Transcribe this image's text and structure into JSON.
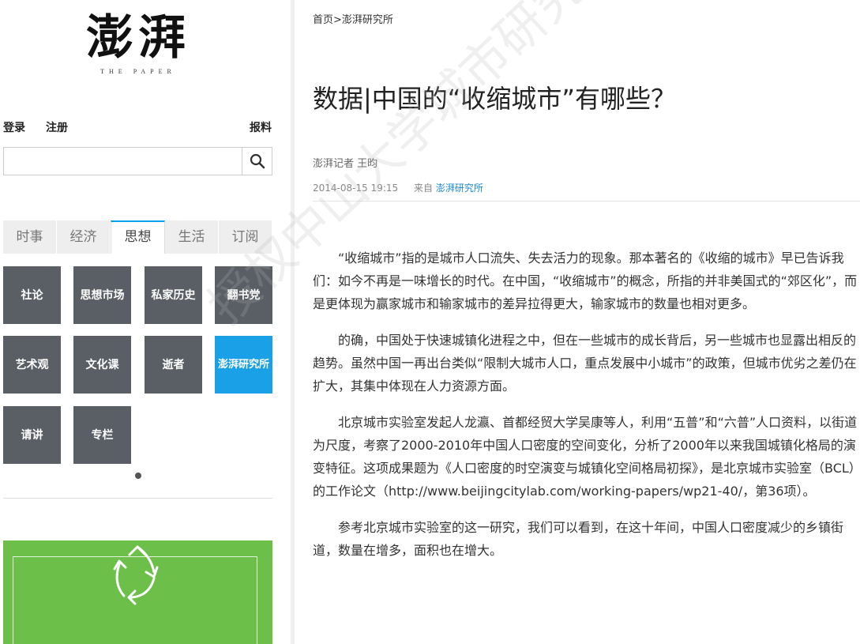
{
  "logo": {
    "cn": "澎湃",
    "en": "THE PAPER"
  },
  "auth": {
    "login": "登录",
    "register": "注册",
    "report": "报料"
  },
  "search": {
    "value": "",
    "placeholder": ""
  },
  "tabs": [
    {
      "label": "时事",
      "active": false
    },
    {
      "label": "经济",
      "active": false
    },
    {
      "label": "思想",
      "active": true
    },
    {
      "label": "生活",
      "active": false
    },
    {
      "label": "订阅",
      "active": false
    }
  ],
  "tiles": [
    {
      "label": "社论"
    },
    {
      "label": "思想市场"
    },
    {
      "label": "私家历史"
    },
    {
      "label": "翻书党"
    },
    {
      "label": "艺术观"
    },
    {
      "label": "文化课"
    },
    {
      "label": "逝者"
    },
    {
      "label": "澎湃研究所",
      "active": true
    },
    {
      "label": "请讲"
    },
    {
      "label": "专栏"
    }
  ],
  "colors": {
    "accent": "#1aa0e6",
    "tile": "#5a5f66",
    "banner": "#6cc04a"
  },
  "breadcrumb": {
    "home": "首页",
    "sep": ">",
    "section": "澎湃研究所"
  },
  "article": {
    "title": "数据|中国的“收缩城市”有哪些？",
    "author": "澎湃记者 王昀",
    "datetime": "2014-08-15 19:15",
    "source_label": "来自",
    "source": "澎湃研究所",
    "paragraphs": [
      "“收缩城市”指的是城市人口流失、失去活力的现象。那本著名的《收缩的城市》早已告诉我们：如今不再是一味增长的时代。在中国，“收缩城市”的概念，所指的并非美国式的“郊区化”，而是更体现为赢家城市和输家城市的差异拉得更大，输家城市的数量也相对更多。",
      "的确，中国处于快速城镇化进程之中，但在一些城市的成长背后，另一些城市也显露出相反的趋势。虽然中国一再出台类似“限制大城市人口，重点发展中小城市”的政策，但城市优劣之差仍在扩大，其集中体现在人力资源方面。",
      "北京城市实验室发起人龙瀛、首都经贸大学吴康等人，利用“五普”和“六普”人口资料，以街道为尺度，考察了2000-2010年中国人口密度的空间变化，分析了2000年以来我国城镇化格局的演变特征。这项成果题为《人口密度的时空演变与城镇化空间格局初探》，是北京城市实验室（BCL）的工作论文（http://www.beijingcitylab.com/working-papers/wp21-40/，第36项）。",
      "参考北京城市实验室的这一研究，我们可以看到，在这十年间，中国人口密度减少的乡镇街道，数量在增多，面积也在增大。"
    ]
  },
  "watermark": "授权中山大学城市研究院发布"
}
